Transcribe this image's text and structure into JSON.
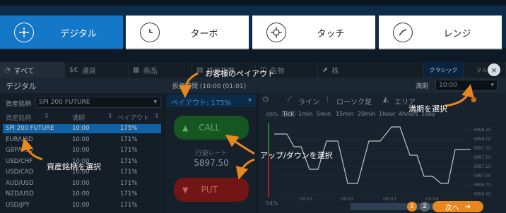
{
  "mode_tabs": [
    {
      "label": "デジタル",
      "icon": "digital-icon"
    },
    {
      "label": "ターボ",
      "icon": "clock-icon"
    },
    {
      "label": "タッチ",
      "icon": "target-icon"
    },
    {
      "label": "レンジ",
      "icon": "range-icon"
    }
  ],
  "asset_tabs": [
    "すべて",
    "通貨",
    "商品",
    "株価指数",
    "先物",
    "株"
  ],
  "asset_tab_prefixes": {
    "currency": "$€",
    "stocks": "CFD"
  },
  "subheader": {
    "title": "デジタル",
    "invest_label": "投資時間 (10:00 (01:01)",
    "expiry_label": "満期"
  },
  "expiry_select": {
    "value": "10:00"
  },
  "asset_select": {
    "label": "資産銘柄",
    "value": "SPI 200 FUTURE"
  },
  "table_headers": {
    "asset": "資産銘柄",
    "expiry": "満期",
    "payout": "ペイアウト"
  },
  "rows": [
    {
      "asset": "SPI 200 FUTURE",
      "expiry": "10:00",
      "payout": "175%"
    },
    {
      "asset": "EUR/USD",
      "expiry": "10:00",
      "payout": "171%"
    },
    {
      "asset": "GBP/USD",
      "expiry": "10:00",
      "payout": "171%"
    },
    {
      "asset": "USD/CHF",
      "expiry": "10:00",
      "payout": "171%"
    },
    {
      "asset": "USD/CAD",
      "expiry": "10:00",
      "payout": "171%"
    },
    {
      "asset": "AUD/USD",
      "expiry": "10:00",
      "payout": "171%"
    },
    {
      "asset": "NZD/USD",
      "expiry": "10:00",
      "payout": "171%"
    },
    {
      "asset": "USD/JPY",
      "expiry": "10:00",
      "payout": "171%"
    }
  ],
  "payout_header": "ペイアウト: 175%",
  "call_label": "CALL",
  "put_label": "PUT",
  "strike_label": "行使レート",
  "strike_value": "5897.50",
  "chart_tabs": [
    "ライン",
    "ローソク足",
    "エリア"
  ],
  "timeframes": [
    "Tick",
    "1min",
    "5min",
    "15min",
    "20min",
    "1hour",
    "4hours",
    "1day"
  ],
  "percent_call": "46%",
  "percent_put": "54%",
  "price_ticks": [
    "5898.25",
    "5898.00",
    "5897.75",
    "5897.50",
    "5897.25",
    "5897.00",
    "5896.75",
    "5896.50"
  ],
  "time_ticks": [
    "09:51",
    "09:52",
    "09:53",
    "09:54"
  ],
  "annotations": {
    "payout": "お客様のペイアウト",
    "expiry": "満期を選択",
    "updown": "アップ/ダウンを選択",
    "asset": "資産銘柄を選択"
  },
  "close_label": "×",
  "pager": {
    "p1": "1",
    "p2": "2",
    "next": "次へ"
  },
  "classic_label": "クラシック",
  "more_label": "マルチ",
  "colors": {
    "accent": "#1577c8",
    "orange": "#e8871d",
    "call": "#1a6a2a",
    "put": "#8a1a1a"
  }
}
